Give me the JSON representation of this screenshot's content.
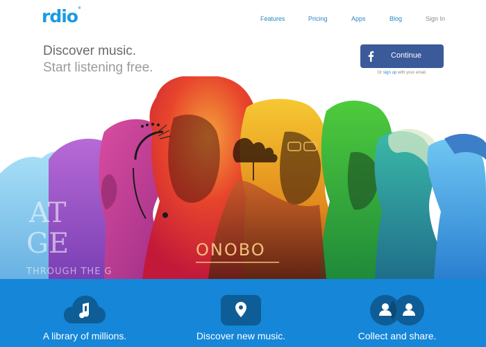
{
  "header": {
    "logo": "rdio",
    "nav": [
      {
        "label": "Features"
      },
      {
        "label": "Pricing"
      },
      {
        "label": "Apps"
      },
      {
        "label": "Blog"
      },
      {
        "label": "Sign In"
      }
    ]
  },
  "hero": {
    "line1": "Discover music.",
    "line2": "Start listening free.",
    "cta_label": "Continue",
    "cta_icon": "facebook-icon",
    "cta_sub_prefix": "Or",
    "cta_sub_link": "sign up",
    "cta_sub_suffix": "with your email.",
    "art_text": {
      "album1_big": "AT",
      "album1_big2": "GE",
      "album1_small": "THROUGH THE G",
      "album2": "ONOBO"
    }
  },
  "features": [
    {
      "label": "A library of millions.",
      "icon": "music-note-cloud-icon"
    },
    {
      "label": "Discover new music.",
      "icon": "location-pin-icon"
    },
    {
      "label": "Collect and share.",
      "icon": "users-icon"
    }
  ],
  "colors": {
    "brand": "#1b9ae0",
    "band": "#1586d8",
    "facebook": "#3b5a9a",
    "icon_bg": "#0e5d96"
  }
}
